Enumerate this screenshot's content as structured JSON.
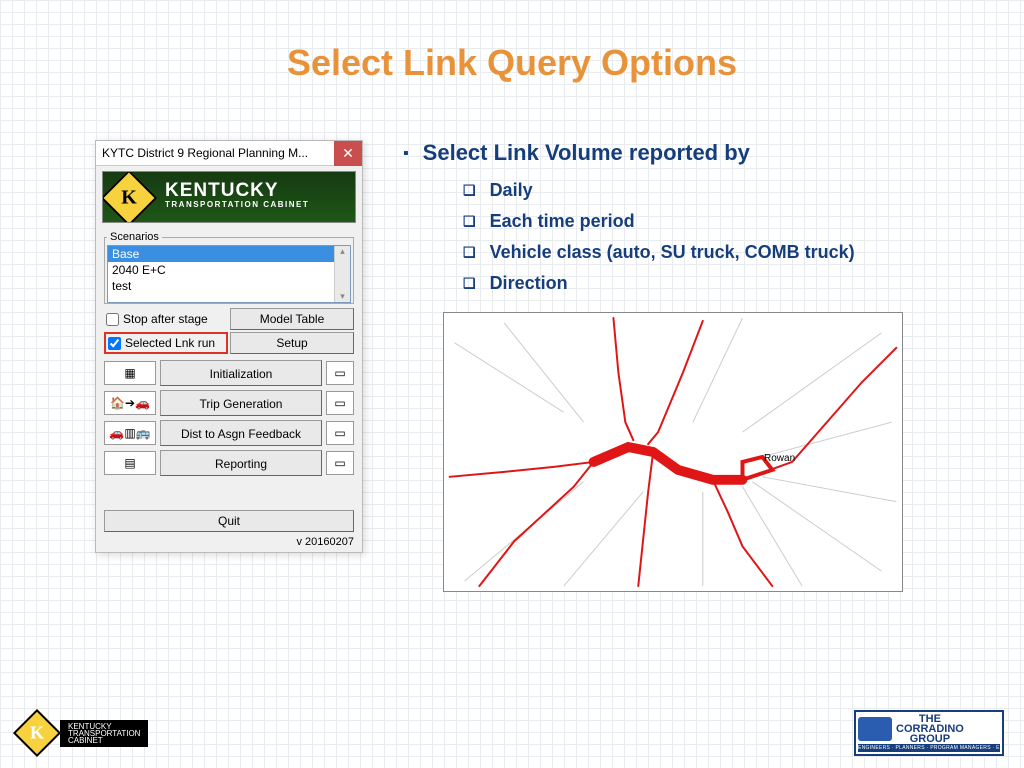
{
  "title": "Select Link Query Options",
  "dialog": {
    "window_title": "KYTC District 9 Regional Planning M...",
    "banner_line1": "KENTUCKY",
    "banner_line2": "TRANSPORTATION CABINET",
    "scenarios_legend": "Scenarios",
    "scenarios": [
      "Base",
      "2040 E+C",
      "test"
    ],
    "selected_scenario": "Base",
    "check_stop": "Stop after stage",
    "check_sel": "Selected Lnk run",
    "btn_model_table": "Model Table",
    "btn_setup": "Setup",
    "stages": {
      "init": "Initialization",
      "trip": "Trip Generation",
      "dist": "Dist to Asgn Feedback",
      "rep": "Reporting"
    },
    "quit": "Quit",
    "version": "v 20160207"
  },
  "right": {
    "heading": "Select Link Volume reported by",
    "options": [
      "Daily",
      "Each time period",
      "Vehicle class (auto, SU truck, COMB truck)",
      "Direction"
    ],
    "map_label": "Rowan"
  },
  "footer": {
    "ky1": "KENTUCKY",
    "ky2": "TRANSPORTATION",
    "ky3": "CABINET",
    "corr1": "THE",
    "corr2": "CORRADINO",
    "corr3": "GROUP",
    "corr_sub": "ENGINEERS · PLANNERS · PROGRAM MANAGERS · ENVIRONMENTAL SCIENTISTS"
  }
}
